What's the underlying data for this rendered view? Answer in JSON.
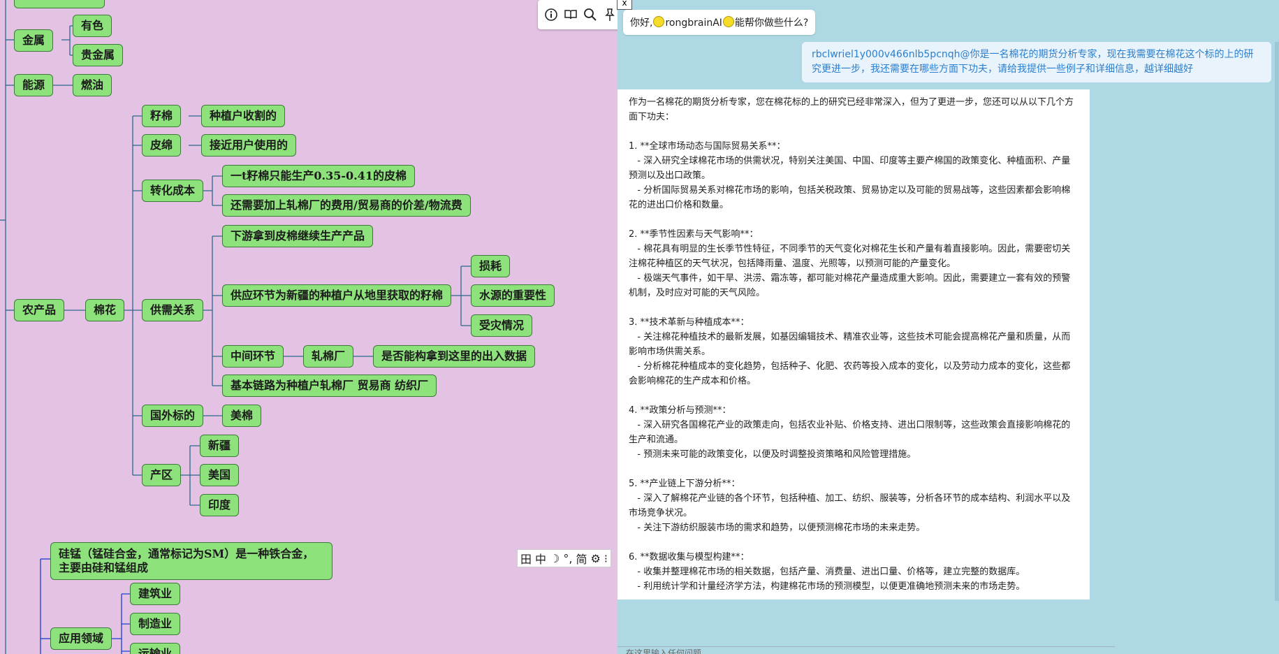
{
  "mindmap": {
    "nodes": {
      "metal": "金属",
      "nonferrous": "有色",
      "precious": "贵金属",
      "energy": "能源",
      "fuel_oil": "燃油",
      "agri": "农产品",
      "cotton": "棉花",
      "seed_cotton": "籽棉",
      "seed_cotton_note": "种植户收割的",
      "lint": "皮绵",
      "lint_note": "接近用户使用的",
      "conversion_cost": "转化成本",
      "conv_1": "一t籽棉只能生产0.35-0.41的皮棉",
      "conv_2": "还需要加上轧棉厂的费用/贸易商的价差/物流费",
      "supply_demand": "供需关系",
      "sd_down": "下游拿到皮棉继续生产产品",
      "sd_supply": "供应环节为新疆的种植户从地里获取的籽棉",
      "loss": "损耗",
      "water": "水源的重要性",
      "disaster": "受灾情况",
      "middle": "中间环节",
      "gin": "轧棉厂",
      "gin_data": "是否能构拿到这里的出入数据",
      "chain": "基本链路为种植户轧棉厂 贸易商 纺织厂",
      "foreign": "国外标的",
      "us_cotton": "美棉",
      "region": "产区",
      "xinjiang": "新疆",
      "usa": "美国",
      "india": "印度",
      "simn": "硅锰（锰硅合金，通常标记为SM）是一种铁合金，主要由硅和锰组成",
      "application": "应用领域",
      "construction": "建筑业",
      "manufacturing": "制造业",
      "transport": "运输业"
    }
  },
  "toolbar": {
    "icons": [
      "info-icon",
      "book-icon",
      "search-icon",
      "pin-icon"
    ]
  },
  "ime": {
    "items": [
      "田",
      "中",
      "☽",
      "°,",
      "简",
      "⚙",
      "⁝"
    ]
  },
  "chat": {
    "close": "x",
    "greeting_pre": "你好,",
    "greeting_name": "rongbrainAI",
    "greeting_post": "能帮你做些什么?",
    "user_message": "rbclwriel1y000v466nlb5pcnqh@你是一名棉花的期货分析专家，现在我需要在棉花这个标的上的研究更进一步，我还需要在哪些方面下功夫，请给我提供一些例子和详细信息，越详细越好",
    "answer_lines": [
      "作为一名棉花的期货分析专家，您在棉花标的上的研究已经非常深入，但为了更进一步，您还可以从以下几个方面下功夫：",
      "",
      "1. **全球市场动态与国际贸易关系**：",
      "   - 深入研究全球棉花市场的供需状况，特别关注美国、中国、印度等主要产棉国的政策变化、种植面积、产量预测以及出口政策。",
      "   - 分析国际贸易关系对棉花市场的影响，包括关税政策、贸易协定以及可能的贸易战等，这些因素都会影响棉花的进出口价格和数量。",
      "",
      "2. **季节性因素与天气影响**：",
      "   - 棉花具有明显的生长季节性特征，不同季节的天气变化对棉花生长和产量有着直接影响。因此，需要密切关注棉花种植区的天气状况，包括降雨量、温度、光照等，以预测可能的产量变化。",
      "   - 极端天气事件，如干旱、洪涝、霜冻等，都可能对棉花产量造成重大影响。因此，需要建立一套有效的预警机制，及时应对可能的天气风险。",
      "",
      "3. **技术革新与种植成本**：",
      "   - 关注棉花种植技术的最新发展，如基因编辑技术、精准农业等，这些技术可能会提高棉花产量和质量，从而影响市场供需关系。",
      "   - 分析棉花种植成本的变化趋势，包括种子、化肥、农药等投入成本的变化，以及劳动力成本的变化，这些都会影响棉花的生产成本和价格。",
      "",
      "4. **政策分析与预测**：",
      "   - 深入研究各国棉花产业的政策走向，包括农业补贴、价格支持、进出口限制等，这些政策会直接影响棉花的生产和流通。",
      "   - 预测未来可能的政策变化，以便及时调整投资策略和风险管理措施。",
      "",
      "5. **产业链上下游分析**：",
      "   - 深入了解棉花产业链的各个环节，包括种植、加工、纺织、服装等，分析各环节的成本结构、利润水平以及市场竞争状况。",
      "   - 关注下游纺织服装市场的需求和趋势，以便预测棉花市场的未来走势。",
      "",
      "6. **数据收集与模型构建**：",
      "   - 收集并整理棉花市场的相关数据，包括产量、消费量、进出口量、价格等，建立完整的数据库。",
      "   - 利用统计学和计量经济学方法，构建棉花市场的预测模型，以便更准确地预测未来的市场走势。"
    ],
    "input_placeholder": "在这里输入任何问题"
  }
}
